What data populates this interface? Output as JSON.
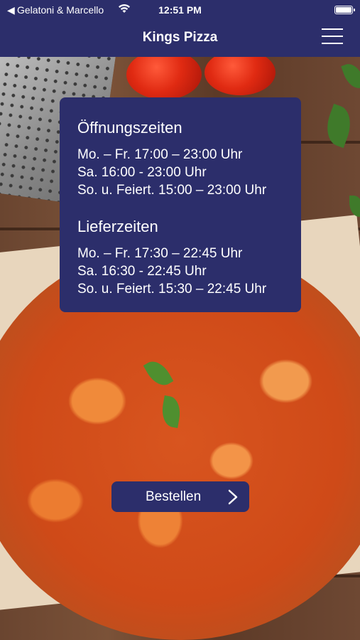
{
  "status_bar": {
    "back_glyph": "◀",
    "carrier": "Gelatoni & Marcello",
    "time": "12:51 PM"
  },
  "nav": {
    "title": "Kings Pizza",
    "menu_icon": "hamburger-menu-icon"
  },
  "opening_hours": {
    "title": "Öffnungszeiten",
    "lines": [
      "Mo. – Fr. 17:00 – 23:00 Uhr",
      "Sa. 16:00 - 23:00 Uhr",
      "So. u. Feiert. 15:00 – 23:00 Uhr"
    ]
  },
  "delivery_hours": {
    "title": "Lieferzeiten",
    "lines": [
      "Mo. – Fr. 17:30 – 22:45 Uhr",
      "Sa. 16:30 - 22:45 Uhr",
      "So. u. Feiert. 15:30 – 22:45 Uhr"
    ]
  },
  "order_button": {
    "label": "Bestellen",
    "icon": "chevron-right-icon"
  },
  "colors": {
    "primary": "#2c2e6b",
    "text": "#ffffff"
  }
}
